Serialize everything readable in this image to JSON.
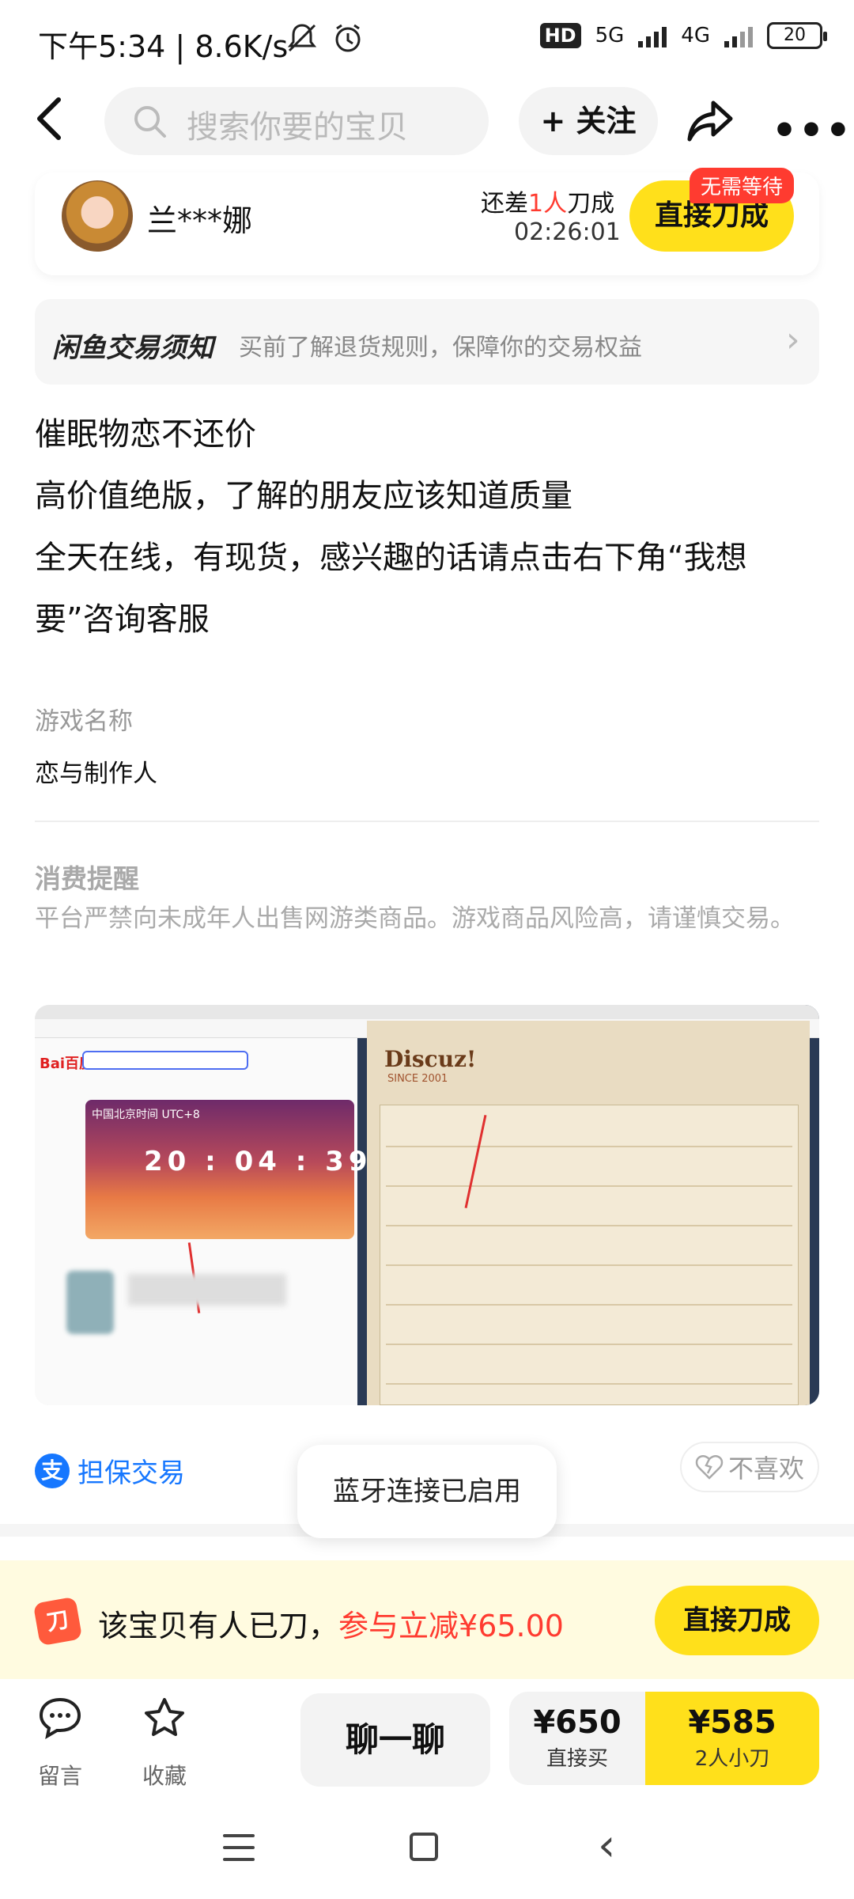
{
  "status_bar": {
    "time": "下午5:34",
    "speed": "8.6K/s",
    "hd": "HD",
    "net1": "5G",
    "net2": "4G",
    "battery": "20"
  },
  "header": {
    "search_placeholder": "搜索你要的宝贝",
    "follow_label": "+ 关注"
  },
  "seller": {
    "name": "兰***娜",
    "need_prefix": "还差",
    "need_count": "1人",
    "need_suffix": "刀成",
    "countdown": "02:26:01",
    "cut_button": "直接刀成",
    "no_wait_badge": "无需等待"
  },
  "notice": {
    "title": "闲鱼交易须知",
    "desc": "买前了解退货规则，保障你的交易权益"
  },
  "description": {
    "line1": "催眠物恋不还价",
    "line2": "高价值绝版，了解的朋友应该知道质量",
    "line3": "全天在线，有现货，感兴趣的话请点击右下角“我想要”咨询客服"
  },
  "details": {
    "game_label": "游戏名称",
    "game_value": "恋与制作人",
    "warn_title": "消费提醒",
    "warn_text": "平台严禁向未成年人出售网游类商品。游戏商品风险高，请谨慎交易。"
  },
  "image": {
    "clock": "20 : 04 : 39",
    "timezone": "中国北京时间 UTC+8",
    "discuz_logo": "Discuz!",
    "discuz_since": "SINCE 2001",
    "baidu": "Bai百度"
  },
  "guarantee": {
    "label": "担保交易",
    "icon_char": "支"
  },
  "dislike_label": "不喜欢",
  "toast": "蓝牙连接已启用",
  "banner": {
    "icon_char": "刀",
    "text_prefix": "该宝贝有人已刀，",
    "text_red": "参与立减¥65.00",
    "button": "直接刀成"
  },
  "bottom_bar": {
    "comment": "留言",
    "favorite": "收藏",
    "chat": "聊一聊",
    "buy_price": "¥650",
    "buy_label": "直接买",
    "cut_price": "¥585",
    "cut_label": "2人小刀"
  },
  "colors": {
    "brand_yellow": "#ffe01b",
    "alert_red": "#ff3b30",
    "trust_blue": "#1677ff"
  }
}
